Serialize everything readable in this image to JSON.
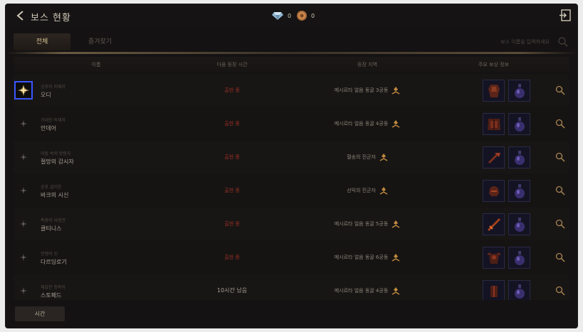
{
  "header": {
    "title": "보스 현황",
    "currencies": [
      {
        "icon": "diamond-icon",
        "value": "0"
      },
      {
        "icon": "coin-icon",
        "value": "0"
      }
    ]
  },
  "tabs": [
    {
      "label": "전체",
      "active": true
    },
    {
      "label": "즐겨찾기",
      "active": false
    }
  ],
  "search": {
    "placeholder": "보스 이름을 입력하세요"
  },
  "table": {
    "columns": [
      "이름",
      "다음 등장 시간",
      "등장 지역",
      "주요 보상 정보"
    ],
    "rows": [
      {
        "subtitle": "공포의 지배자",
        "name": "오디",
        "next": "출현 중",
        "location": "메시르타 얼음 동굴 3공동",
        "selected": true
      },
      {
        "subtitle": "거대한 독재자",
        "name": "안데어",
        "next": "출현 중",
        "location": "메시르타 얼음 동굴 4공동",
        "selected": false
      },
      {
        "subtitle": "어둠 속의 방랑자",
        "name": "절망의 감시자",
        "next": "출현 중",
        "location": "혈송의 진군자",
        "selected": false
      },
      {
        "subtitle": "공포 걸이운",
        "name": "바크의 시신",
        "next": "출현 중",
        "location": "선익의 진군자",
        "selected": false
      },
      {
        "subtitle": "폭풍의 사령관",
        "name": "클티니스",
        "next": "출현 중",
        "location": "메시르타 얼음 동굴 5공동",
        "selected": false
      },
      {
        "subtitle": "전쟁의 신",
        "name": "다르딩로기",
        "next": "출현 중",
        "location": "메시르타 얼음 동굴 6공동",
        "selected": false
      },
      {
        "subtitle": "재갈한 정복자",
        "name": "스토페드",
        "next": "10시간 남음",
        "location": "메시르타 얼음 동굴 4공동",
        "selected": false
      }
    ]
  },
  "footer": {
    "sort_label": "시간"
  },
  "colors": {
    "background": "#141213",
    "active_status": "#9a2e24",
    "tab_active_text": "#d8c392",
    "selection_outline": "#3a57ff",
    "reward_slot": "#141323"
  }
}
